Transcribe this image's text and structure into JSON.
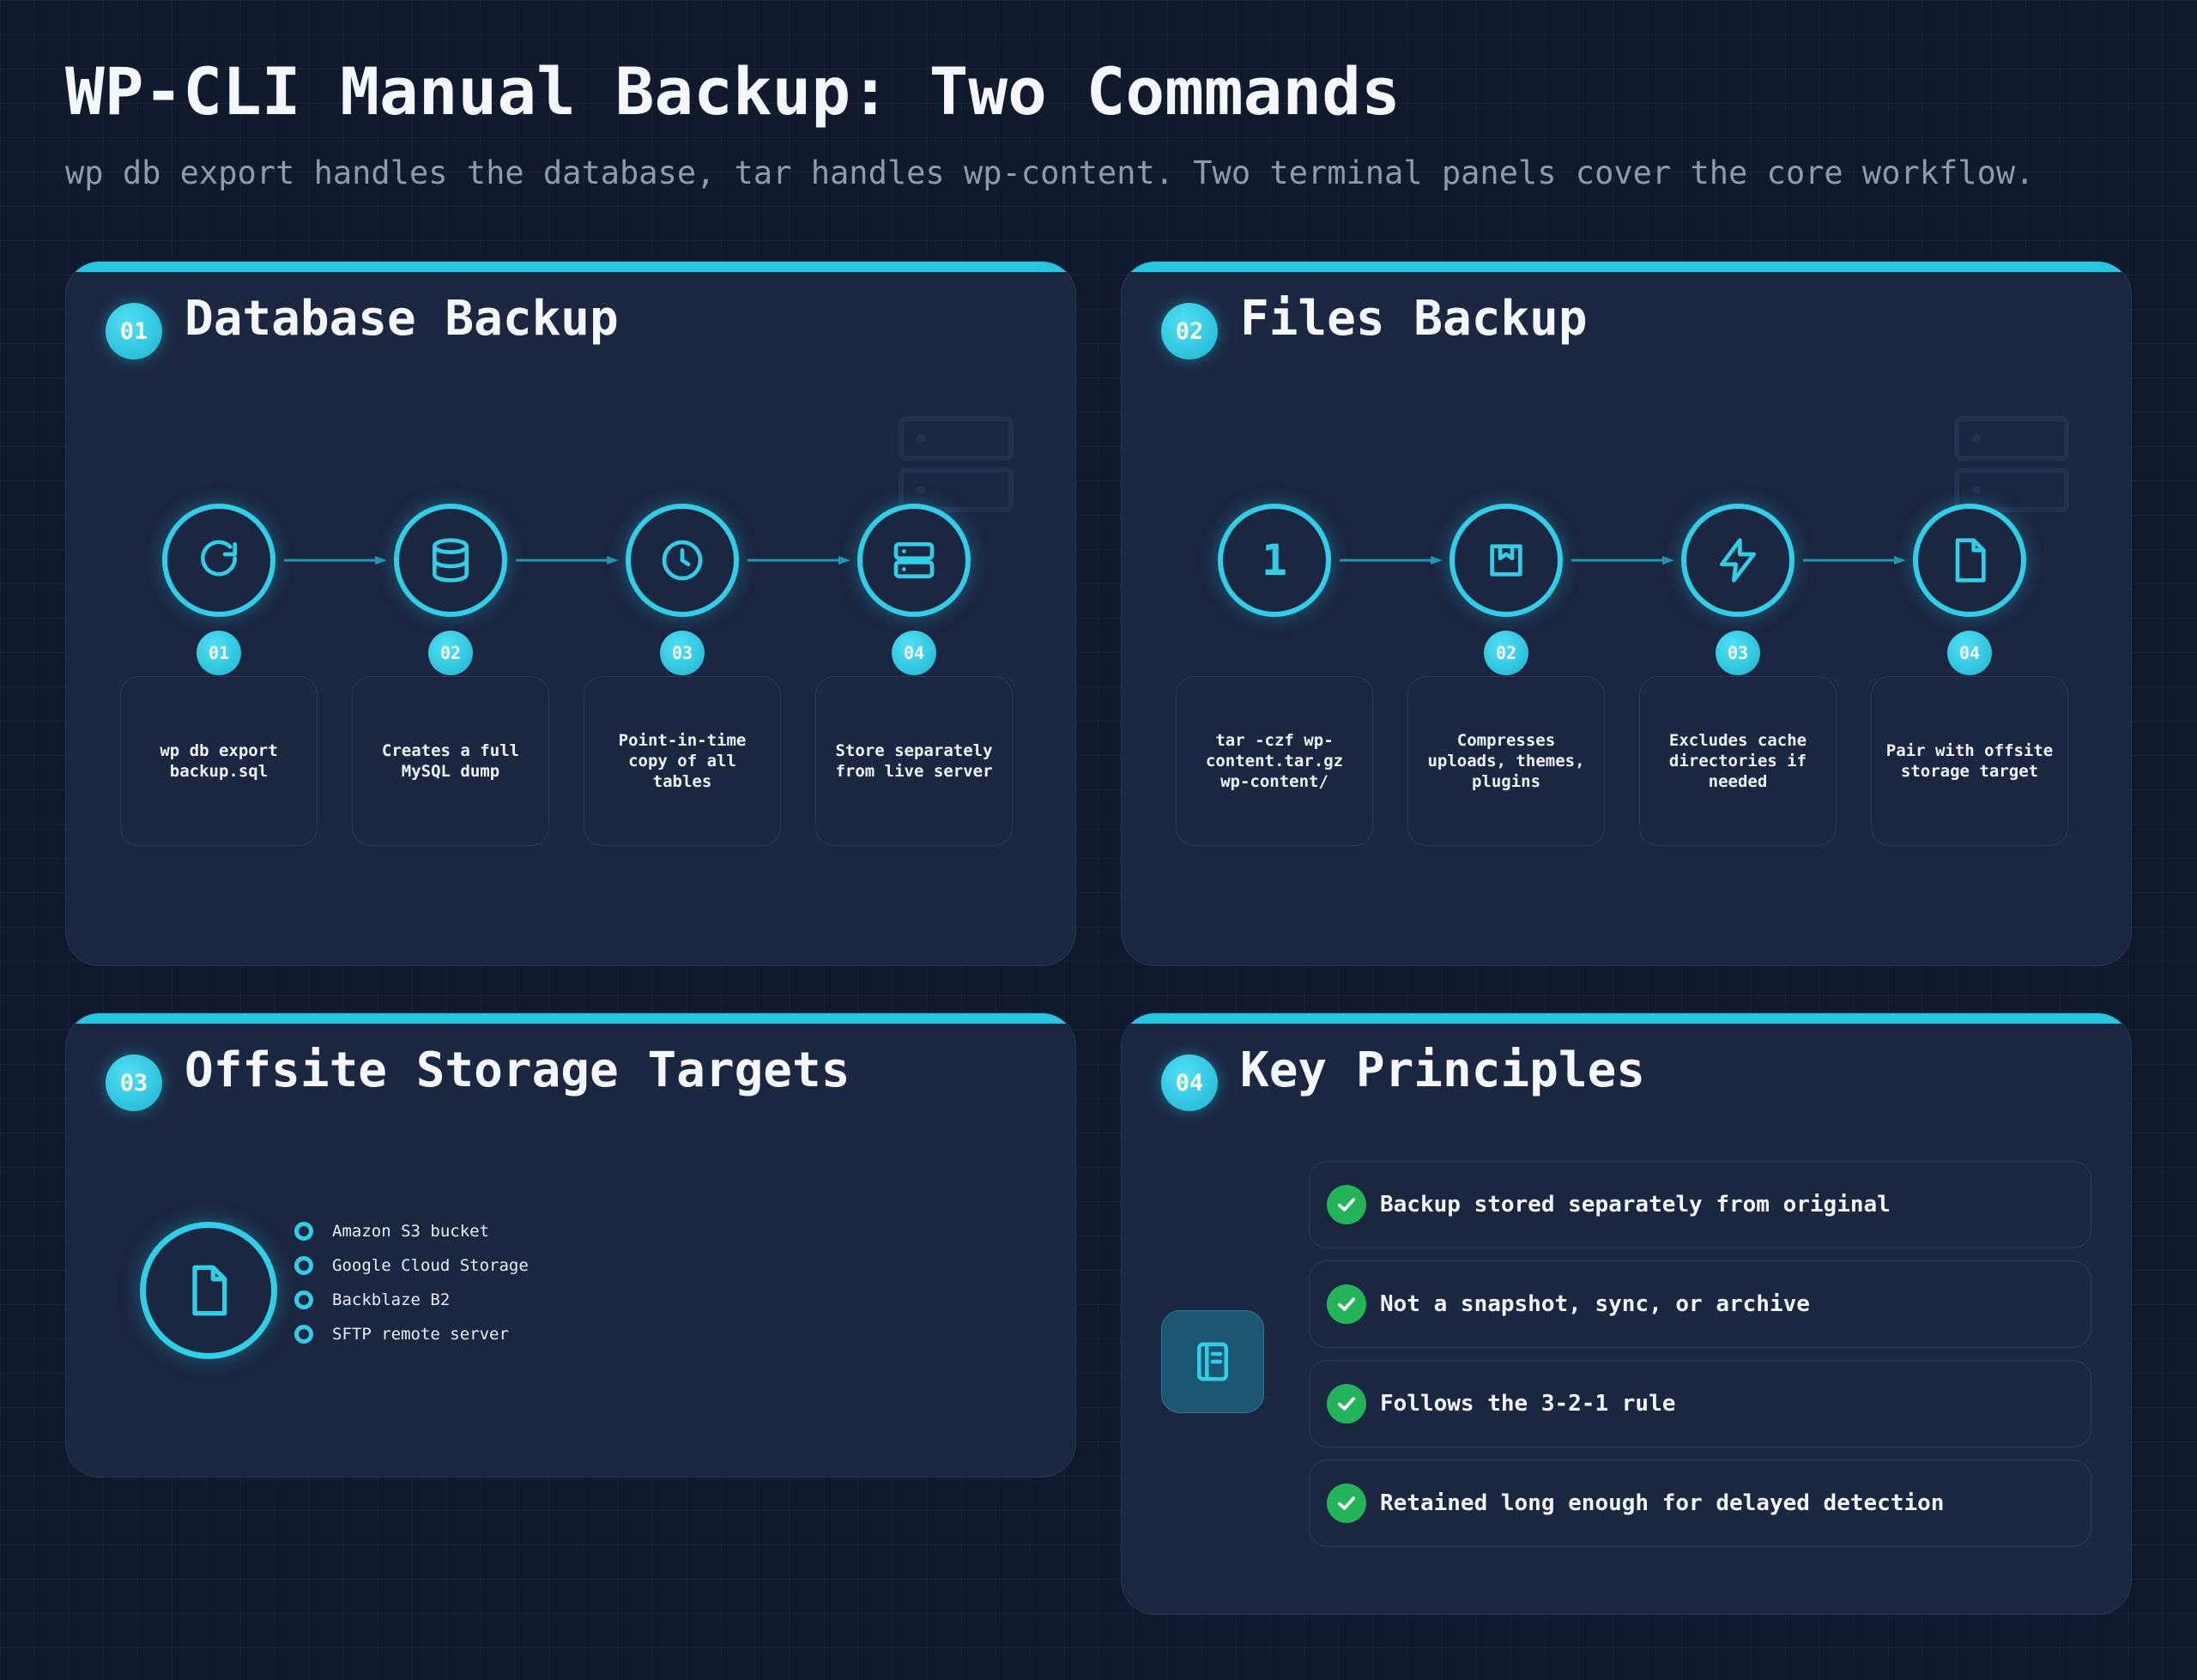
{
  "header": {
    "title": "WP-CLI Manual Backup: Two Commands",
    "subtitle": "wp db export handles the database, tar handles wp-content. Two terminal panels cover the core workflow."
  },
  "colors": {
    "accent": "#23c8e2",
    "panel": "#1b2640",
    "background": "#111a2c",
    "check": "#22b558"
  },
  "panels": [
    {
      "badge": "01",
      "title": "Database Backup",
      "steps": [
        {
          "icon": "refresh-icon",
          "num": "01",
          "text": "wp db export backup.sql"
        },
        {
          "icon": "database-icon",
          "num": "02",
          "text": "Creates a full MySQL dump"
        },
        {
          "icon": "clock-icon",
          "num": "03",
          "text": "Point-in-time copy of all tables"
        },
        {
          "icon": "server-icon",
          "num": "04",
          "text": "Store separately from live server"
        }
      ]
    },
    {
      "badge": "02",
      "title": "Files Backup",
      "steps": [
        {
          "icon": "number-one",
          "ring_label": "1",
          "num": "",
          "text": "tar -czf wp-content.tar.gz wp-content/"
        },
        {
          "icon": "archive-icon",
          "num": "02",
          "text": "Compresses uploads, themes, plugins"
        },
        {
          "icon": "lightning-icon",
          "num": "03",
          "text": "Excludes cache directories if needed"
        },
        {
          "icon": "file-icon",
          "num": "04",
          "text": "Pair with offsite storage target"
        }
      ]
    },
    {
      "badge": "03",
      "title": "Offsite Storage Targets",
      "icon": "file-icon",
      "targets": [
        "Amazon S3 bucket",
        "Google Cloud Storage",
        "Backblaze B2",
        "SFTP remote server"
      ]
    },
    {
      "badge": "04",
      "title": "Key Principles",
      "icon": "notebook-icon",
      "principles": [
        "Backup stored separately from original",
        "Not a snapshot, sync, or archive",
        "Follows the 3-2-1 rule",
        "Retained long enough for delayed detection"
      ]
    }
  ]
}
